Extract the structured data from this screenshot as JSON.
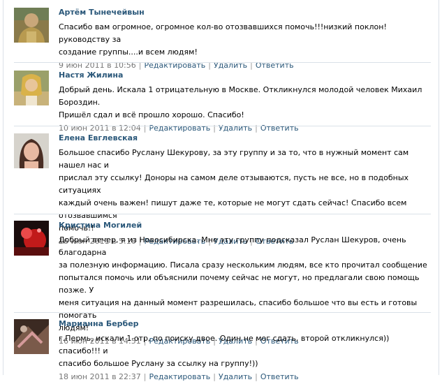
{
  "actions": {
    "edit": "Редактировать",
    "delete": "Удалить",
    "reply": "Ответить",
    "separator": "|"
  },
  "posts": [
    {
      "author": "Артём Тынечейвын",
      "text": "Спасибо вам огромное, огромное кол-во отозвавшихся помочь!!!низкий поклон!руководству за\nсоздание группы....и всем людям!",
      "date": "9 июн 2011 в 10:56"
    },
    {
      "author": "Настя Жилина",
      "text": "Добрый день. Искала 1 отрицательную в Москве. Откликнулся молодой человек Михаил Бороздин.\nПришёл сдал и всё прошло хорошо. Спасибо!",
      "date": "10 июн 2011 в 12:04"
    },
    {
      "author": "Елена Евглевская",
      "text": "Большое спасибо Руслану Шекурову, за эту группу и за то, что в нужный момент сам нашел нас и\nприслал эту ссылку! Доноры на самом деле отзываются, пусть не все, но в подобных ситуациях\nкаждый очень важен! пишут даже те, которые не могут сдать сейчас! Спасибо всем отозвавшимся\nпомочь!!",
      "date": "16 июн 2011 в 5:16"
    },
    {
      "author": "Кристина Могилей",
      "text": "Добрый вечер, я из Новосибирска. Мне эту группу подсказал Руслан Шекуров, очень благодарна\nза полезную информацию. Писала сразу нескольким людям, все кто прочитал сообщение\nпопытался помочь или объяснили почему сейчас не могут, но предлагали свою помощь позже. У\nменя ситуация на данный момент разрешилась, спасибо большое что вы есть и готовы помогать\nлюдям!",
      "date": "16 июн 2011 в 14:51"
    },
    {
      "author": "Марианна Бербер",
      "text": "г.Пермь, искали 1 отр, по поиску двое. Один не мог сдать, второй откликнулся)) спасибо!!! и\nспасибо большое Руслану за ссылку на группу!))",
      "date": "18 июн 2011 в 22:37"
    }
  ]
}
